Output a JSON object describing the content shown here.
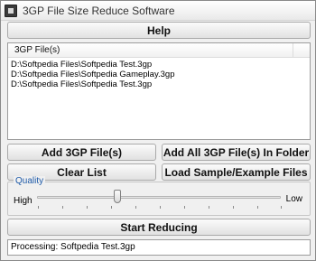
{
  "window": {
    "title": "3GP File Size Reduce Software"
  },
  "buttons": {
    "help": "Help",
    "add_files": "Add 3GP File(s)",
    "add_folder": "Add All 3GP File(s) In Folder",
    "clear_list": "Clear List",
    "load_sample": "Load Sample/Example Files",
    "start": "Start Reducing"
  },
  "file_list": {
    "column_header": "3GP File(s)",
    "items": [
      "D:\\Softpedia Files\\Softpedia Test.3gp",
      "D:\\Softpedia Files\\Softpedia Gameplay.3gp",
      "D:\\Softpedia Files\\Softpedia Test.3gp"
    ]
  },
  "quality": {
    "legend": "Quality",
    "high_label": "High",
    "low_label": "Low",
    "slider_value": 0.33
  },
  "status": {
    "text": "Processing: Softpedia Test.3gp"
  }
}
